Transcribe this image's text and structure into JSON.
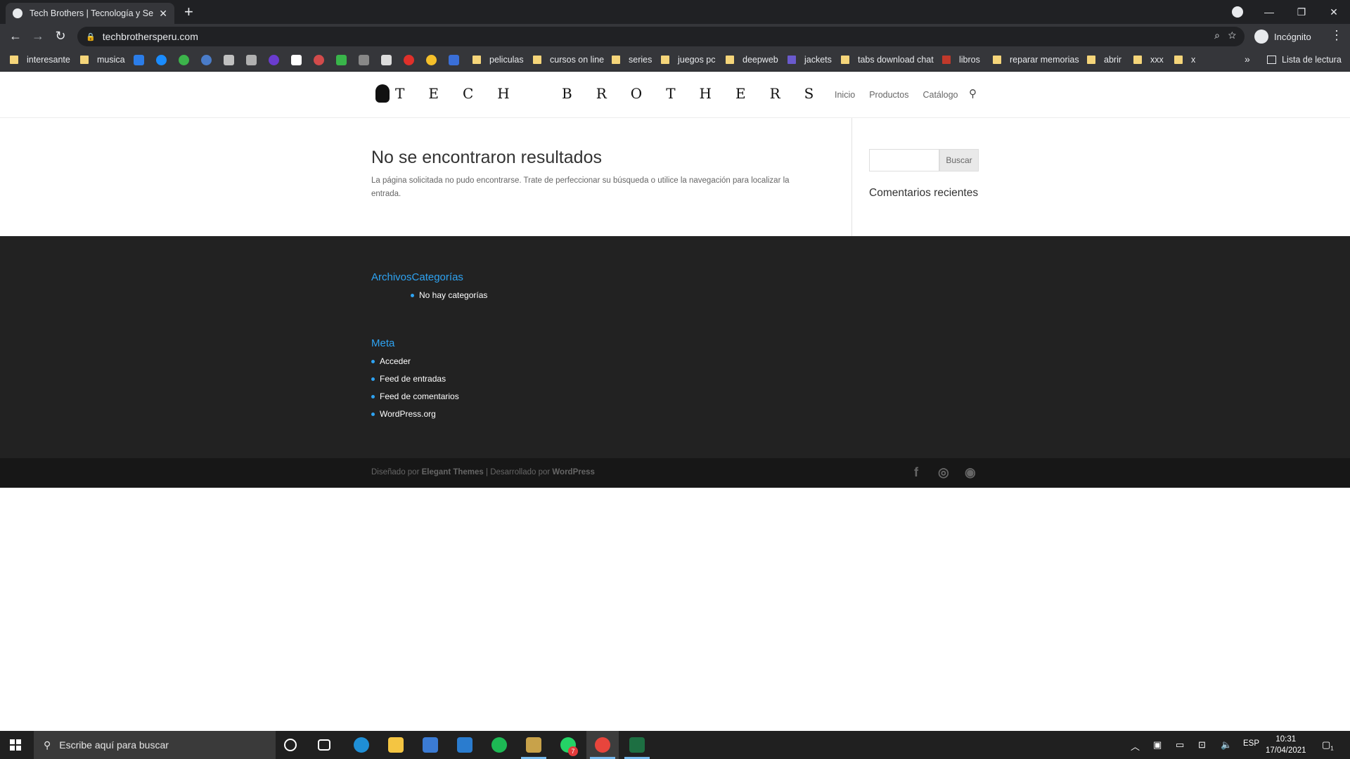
{
  "browser": {
    "tab_title": "Tech Brothers | Tecnología y Servicios",
    "tab_close": "✕",
    "new_tab": "+",
    "url": "techbrothersperu.com",
    "profile_label": "Incógnito",
    "bookmarks": [
      "interesante",
      "musica",
      "peliculas",
      "cursos on line",
      "series",
      "juegos pc",
      "deepweb",
      "jackets",
      "tabs download chat",
      "libros",
      "reparar memorias",
      "abrir",
      "xxx",
      "x"
    ],
    "overflow": "»",
    "reading_list": "Lista de lectura"
  },
  "site": {
    "logo_text": "TECH BROTHERS",
    "nav": [
      "Inicio",
      "Productos",
      "Catálogo"
    ],
    "heading": "No se encontraron resultados",
    "description": "La página solicitada no pudo encontrarse. Trate de perfeccionar su búsqueda o utilice la navegación para localizar la entrada.",
    "search_button": "Buscar",
    "sidebar_title": "Comentarios recientes",
    "footer": {
      "archivos_title": "Archivos",
      "categorias_title": "Categorías",
      "categorias_items": [
        "No hay categorías"
      ],
      "meta_title": "Meta",
      "meta_items": [
        "Acceder",
        "Feed de entradas",
        "Feed de comentarios",
        "WordPress.org"
      ]
    },
    "credits": {
      "designed_by": "Diseñado por ",
      "elegant": "Elegant Themes",
      "sep": " | Desarrollado por ",
      "wordpress": "WordPress"
    },
    "social": [
      "facebook-icon",
      "instagram-icon",
      "rss-icon"
    ]
  },
  "taskbar": {
    "search_placeholder": "Escribe aquí para buscar",
    "whatsapp_badge": "7",
    "language": "ESP",
    "time": "10:31",
    "date": "17/04/2021",
    "notif_count": "1"
  },
  "colors": {
    "accent": "#2ea3f2",
    "footer_bg": "#222222",
    "bottom_bar_bg": "#171717",
    "chrome_dark": "#202124",
    "chrome_mid": "#35363a"
  }
}
